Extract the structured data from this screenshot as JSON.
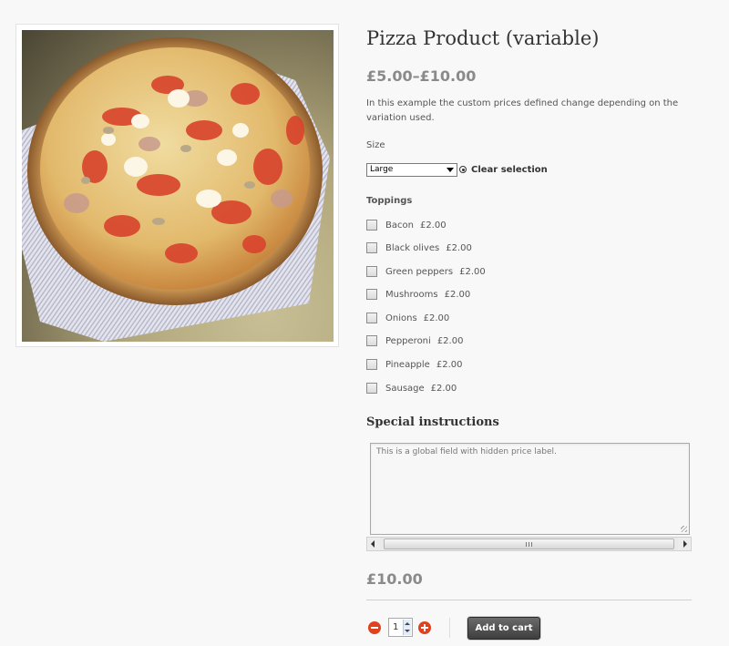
{
  "product": {
    "image_alt": "pizza photo",
    "title": "Pizza Product (variable)",
    "price_range": "£5.00–£10.00",
    "description": "In this example the custom prices defined change depending on the variation used."
  },
  "variation": {
    "label": "Size",
    "selected": "Large",
    "clear_label": "Clear selection"
  },
  "toppings": {
    "label": "Toppings",
    "items": [
      {
        "name": "Bacon",
        "price": "£2.00"
      },
      {
        "name": "Black olives",
        "price": "£2.00"
      },
      {
        "name": "Green peppers",
        "price": "£2.00"
      },
      {
        "name": "Mushrooms",
        "price": "£2.00"
      },
      {
        "name": "Onions",
        "price": "£2.00"
      },
      {
        "name": "Pepperoni",
        "price": "£2.00"
      },
      {
        "name": "Pineapple",
        "price": "£2.00"
      },
      {
        "name": "Sausage",
        "price": "£2.00"
      }
    ]
  },
  "special_instructions": {
    "heading": "Special instructions",
    "value": "This is a global field with hidden price label."
  },
  "cart": {
    "total_price": "£10.00",
    "quantity": "1",
    "add_to_cart_label": "Add to cart"
  },
  "colors": {
    "accent_orange": "#e0421f",
    "price_gray": "#8a8a8a",
    "button_dark": "#4a4a4a"
  }
}
